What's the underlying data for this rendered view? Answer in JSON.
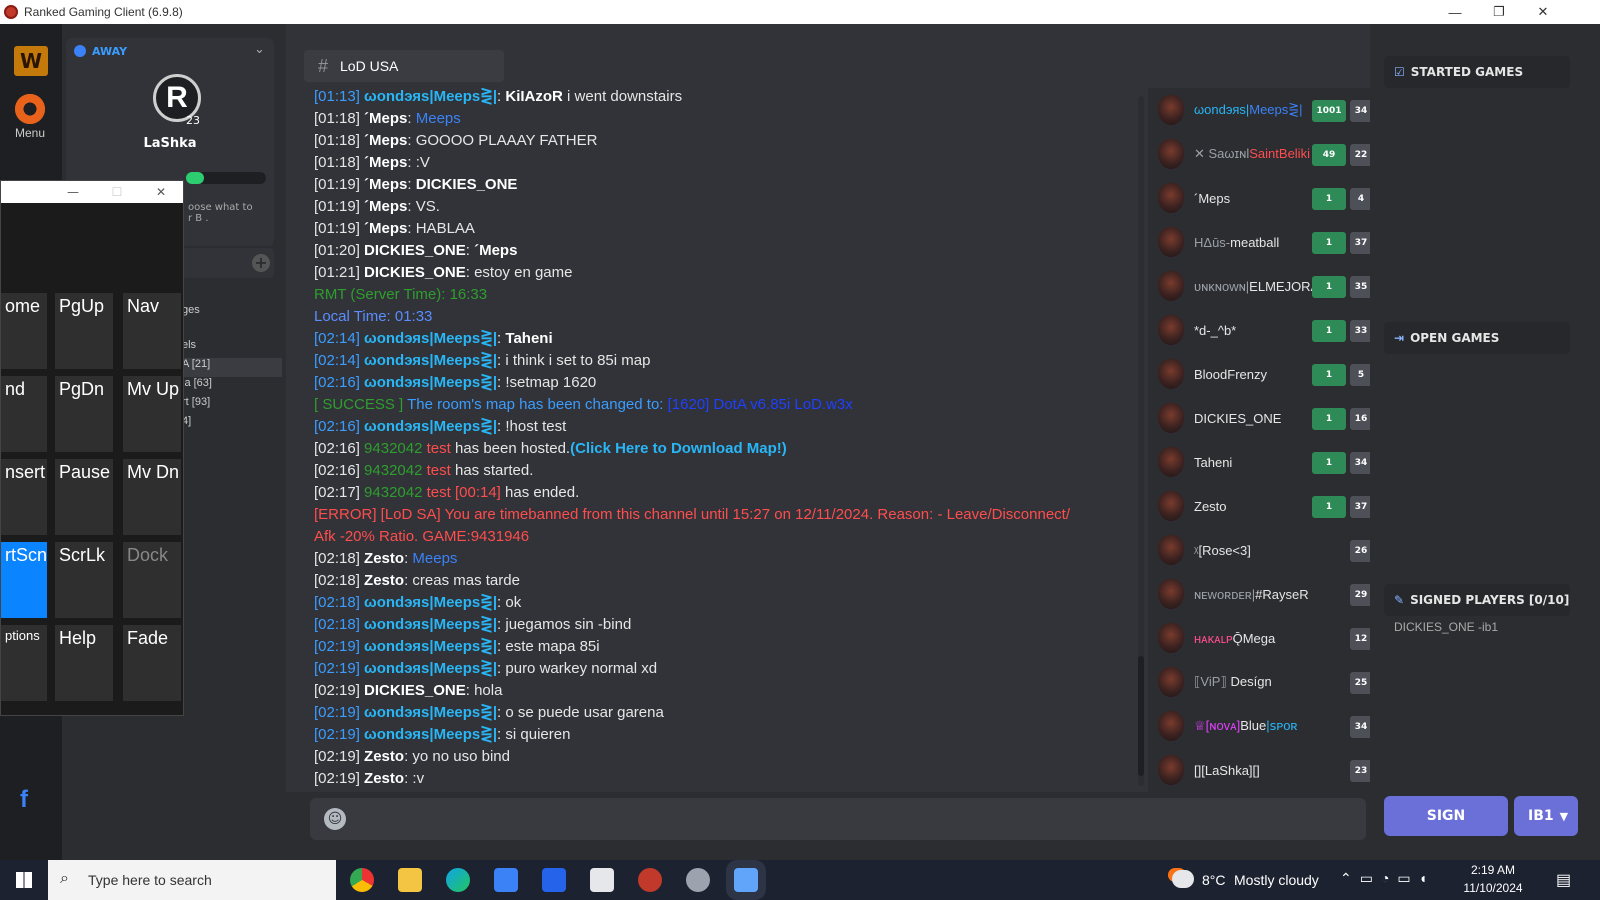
{
  "window": {
    "title": "Ranked Gaming Client (6.9.8)",
    "minimize": "—",
    "restore": "❐",
    "close": "✕"
  },
  "rail": {
    "menu_label": "Menu"
  },
  "profile": {
    "status": "AWAY",
    "name": "LaShka",
    "level": "23",
    "hint": "oose what to\nr B ."
  },
  "sidebar": {
    "partial_items": [
      "ges",
      "els",
      "A [21]",
      "ia [63]",
      "rt [93]",
      "4]"
    ]
  },
  "channel": {
    "hash": "#",
    "name": "LoD USA"
  },
  "chat": {
    "lines": [
      [
        {
          "t": "[01:13] ",
          "c": "#3b9dff"
        },
        {
          "t": "ωondэяs|Meeps⋛|",
          "c": "#29b6f6",
          "b": true
        },
        {
          "t": ": ",
          "c": "#e6e6e6"
        },
        {
          "t": "KiIAzoR",
          "c": "#ffffff",
          "b": true
        },
        {
          "t": " i went downstairs",
          "c": "#e6e6e6"
        }
      ],
      [
        {
          "t": "[01:18] ",
          "c": "#e6e6e6"
        },
        {
          "t": "´Meps",
          "c": "#ffffff",
          "b": true
        },
        {
          "t": ": ",
          "c": "#e6e6e6"
        },
        {
          "t": "Meeps",
          "c": "#3b82f6"
        }
      ],
      [
        {
          "t": "[01:18] ",
          "c": "#e6e6e6"
        },
        {
          "t": "´Meps",
          "c": "#ffffff",
          "b": true
        },
        {
          "t": ": GOOOO PLAAAY FATHER",
          "c": "#e6e6e6"
        }
      ],
      [
        {
          "t": "[01:18] ",
          "c": "#e6e6e6"
        },
        {
          "t": "´Meps",
          "c": "#ffffff",
          "b": true
        },
        {
          "t": ": :V",
          "c": "#e6e6e6"
        }
      ],
      [
        {
          "t": "[01:19] ",
          "c": "#e6e6e6"
        },
        {
          "t": "´Meps",
          "c": "#ffffff",
          "b": true
        },
        {
          "t": ": ",
          "c": "#e6e6e6"
        },
        {
          "t": "DICKIES_ONE",
          "c": "#ffffff",
          "b": true
        }
      ],
      [
        {
          "t": "[01:19] ",
          "c": "#e6e6e6"
        },
        {
          "t": "´Meps",
          "c": "#ffffff",
          "b": true
        },
        {
          "t": ": VS.",
          "c": "#e6e6e6"
        }
      ],
      [
        {
          "t": "[01:19] ",
          "c": "#e6e6e6"
        },
        {
          "t": "´Meps",
          "c": "#ffffff",
          "b": true
        },
        {
          "t": ": HABLAA",
          "c": "#e6e6e6"
        }
      ],
      [
        {
          "t": "[01:20] ",
          "c": "#e6e6e6"
        },
        {
          "t": "DICKIES_ONE",
          "c": "#ffffff",
          "b": true
        },
        {
          "t": ": ",
          "c": "#e6e6e6"
        },
        {
          "t": "´Meps",
          "c": "#ffffff",
          "b": true
        }
      ],
      [
        {
          "t": "[01:21] ",
          "c": "#e6e6e6"
        },
        {
          "t": "DICKIES_ONE",
          "c": "#ffffff",
          "b": true
        },
        {
          "t": ": estoy en game",
          "c": "#e6e6e6"
        }
      ],
      [
        {
          "t": "RMT (Server Time): 16:33",
          "c": "#2e9e2e"
        }
      ],
      [
        {
          "t": "Local Time: 01:33",
          "c": "#5b8dff"
        }
      ],
      [
        {
          "t": "[02:14] ",
          "c": "#3b9dff"
        },
        {
          "t": "ωondэяs|Meeps⋛|",
          "c": "#29b6f6",
          "b": true
        },
        {
          "t": ": ",
          "c": "#e6e6e6"
        },
        {
          "t": "Taheni",
          "c": "#ffffff",
          "b": true
        }
      ],
      [
        {
          "t": "[02:14] ",
          "c": "#3b9dff"
        },
        {
          "t": "ωondэяs|Meeps⋛|",
          "c": "#29b6f6",
          "b": true
        },
        {
          "t": ": i think i set to 85i map",
          "c": "#e6e6e6"
        }
      ],
      [
        {
          "t": "[02:16] ",
          "c": "#3b9dff"
        },
        {
          "t": "ωondэяs|Meeps⋛|",
          "c": "#29b6f6",
          "b": true
        },
        {
          "t": ": !setmap 1620",
          "c": "#e6e6e6"
        }
      ],
      [
        {
          "t": "[ SUCCESS ] ",
          "c": "#2e9e2e"
        },
        {
          "t": "The room's map has been changed to: ",
          "c": "#3b9dff"
        },
        {
          "t": "[1620] DotA v6.85i LoD.w3x",
          "c": "#1e40ff"
        }
      ],
      [
        {
          "t": "[02:16] ",
          "c": "#3b9dff"
        },
        {
          "t": "ωondэяs|Meeps⋛|",
          "c": "#29b6f6",
          "b": true
        },
        {
          "t": ": !host test",
          "c": "#e6e6e6"
        }
      ],
      [
        {
          "t": "[02:16] ",
          "c": "#e6e6e6"
        },
        {
          "t": "9432042 ",
          "c": "#2e9e2e"
        },
        {
          "t": "test ",
          "c": "#ff4d4d"
        },
        {
          "t": "has been hosted.",
          "c": "#e6e6e6"
        },
        {
          "t": "(Click Here to Download Map!)",
          "c": "#29b6f6",
          "b": true
        }
      ],
      [
        {
          "t": "[02:16] ",
          "c": "#e6e6e6"
        },
        {
          "t": "9432042 ",
          "c": "#2e9e2e"
        },
        {
          "t": "test ",
          "c": "#ff4d4d"
        },
        {
          "t": "has started.",
          "c": "#e6e6e6"
        }
      ],
      [
        {
          "t": "[02:17] ",
          "c": "#e6e6e6"
        },
        {
          "t": "9432042 ",
          "c": "#2e9e2e"
        },
        {
          "t": "test [00:14] ",
          "c": "#ff4d4d"
        },
        {
          "t": "has ended.",
          "c": "#e6e6e6"
        }
      ],
      [
        {
          "t": "[ERROR] [LoD SA] You are timebanned from this channel until 15:27 on 12/11/2024. Reason: - Leave/Disconnect/",
          "c": "#ff4d4d"
        }
      ],
      [
        {
          "t": "Afk -20% Ratio. GAME:9431946",
          "c": "#ff4d4d"
        }
      ],
      [
        {
          "t": "[02:18] ",
          "c": "#e6e6e6"
        },
        {
          "t": "Zesto",
          "c": "#ffffff",
          "b": true
        },
        {
          "t": ": ",
          "c": "#e6e6e6"
        },
        {
          "t": "Meeps",
          "c": "#3b82f6"
        }
      ],
      [
        {
          "t": "[02:18] ",
          "c": "#e6e6e6"
        },
        {
          "t": "Zesto",
          "c": "#ffffff",
          "b": true
        },
        {
          "t": ": creas mas tarde",
          "c": "#e6e6e6"
        }
      ],
      [
        {
          "t": "[02:18] ",
          "c": "#3b9dff"
        },
        {
          "t": "ωondэяs|Meeps⋛|",
          "c": "#29b6f6",
          "b": true
        },
        {
          "t": ": ok",
          "c": "#e6e6e6"
        }
      ],
      [
        {
          "t": "[02:18] ",
          "c": "#3b9dff"
        },
        {
          "t": "ωondэяs|Meeps⋛|",
          "c": "#29b6f6",
          "b": true
        },
        {
          "t": ": juegamos sin -bind",
          "c": "#e6e6e6"
        }
      ],
      [
        {
          "t": "[02:19] ",
          "c": "#3b9dff"
        },
        {
          "t": "ωondэяs|Meeps⋛|",
          "c": "#29b6f6",
          "b": true
        },
        {
          "t": ": este mapa 85i",
          "c": "#e6e6e6"
        }
      ],
      [
        {
          "t": "[02:19] ",
          "c": "#3b9dff"
        },
        {
          "t": "ωondэяs|Meeps⋛|",
          "c": "#29b6f6",
          "b": true
        },
        {
          "t": ": puro warkey normal xd",
          "c": "#e6e6e6"
        }
      ],
      [
        {
          "t": "[02:19] ",
          "c": "#e6e6e6"
        },
        {
          "t": "DICKIES_ONE",
          "c": "#ffffff",
          "b": true
        },
        {
          "t": ": hola",
          "c": "#e6e6e6"
        }
      ],
      [
        {
          "t": "[02:19] ",
          "c": "#3b9dff"
        },
        {
          "t": "ωondэяs|Meeps⋛|",
          "c": "#29b6f6",
          "b": true
        },
        {
          "t": ": o se puede usar garena",
          "c": "#e6e6e6"
        }
      ],
      [
        {
          "t": "[02:19] ",
          "c": "#3b9dff"
        },
        {
          "t": "ωondэяs|Meeps⋛|",
          "c": "#29b6f6",
          "b": true
        },
        {
          "t": ": si quieren",
          "c": "#e6e6e6"
        }
      ],
      [
        {
          "t": "[02:19] ",
          "c": "#e6e6e6"
        },
        {
          "t": "Zesto",
          "c": "#ffffff",
          "b": true
        },
        {
          "t": ": yo no uso bind",
          "c": "#e6e6e6"
        }
      ],
      [
        {
          "t": "[02:19] ",
          "c": "#e6e6e6"
        },
        {
          "t": "Zesto",
          "c": "#ffffff",
          "b": true
        },
        {
          "t": ": :v",
          "c": "#e6e6e6"
        }
      ]
    ]
  },
  "users": [
    {
      "parts": [
        {
          "t": "ωondэяs|",
          "c": "#29b6f6"
        },
        {
          "t": "Meeps⋛|",
          "c": "#3b82f6"
        }
      ],
      "green": "1001",
      "grey": "34"
    },
    {
      "parts": [
        {
          "t": "✕ Saωɪɴl",
          "c": "#9aa0a6"
        },
        {
          "t": "SaintBeliki",
          "c": "#ff4d4d"
        }
      ],
      "green": "49",
      "grey": "22"
    },
    {
      "parts": [
        {
          "t": "´Meps",
          "c": "#e6e6e6"
        }
      ],
      "green": "1",
      "grey": "4"
    },
    {
      "parts": [
        {
          "t": "HΔūs-",
          "c": "#9aa0a6"
        },
        {
          "t": "meatball",
          "c": "#e6e6e6"
        }
      ],
      "green": "1",
      "grey": "37"
    },
    {
      "parts": [
        {
          "t": "ᴜɴᴋɴᴏᴡɴ|",
          "c": "#9aa0a6"
        },
        {
          "t": "ELMEJORA",
          "c": "#e6e6e6"
        }
      ],
      "green": "1",
      "grey": "35"
    },
    {
      "parts": [
        {
          "t": "*d-_^b*",
          "c": "#e6e6e6"
        }
      ],
      "green": "1",
      "grey": "33"
    },
    {
      "parts": [
        {
          "t": "BloodFrenzy",
          "c": "#e6e6e6"
        }
      ],
      "green": "1",
      "grey": "5"
    },
    {
      "parts": [
        {
          "t": "DICKIES_ONE",
          "c": "#e6e6e6"
        }
      ],
      "green": "1",
      "grey": "16"
    },
    {
      "parts": [
        {
          "t": "Taheni",
          "c": "#e6e6e6"
        }
      ],
      "green": "1",
      "grey": "34"
    },
    {
      "parts": [
        {
          "t": "Zesto",
          "c": "#e6e6e6"
        }
      ],
      "green": "1",
      "grey": "37"
    },
    {
      "parts": [
        {
          "t": "ᵡ",
          "c": "#9aa0a6"
        },
        {
          "t": "[Rose<3]",
          "c": "#e6e6e6"
        }
      ],
      "green": "",
      "grey": "26"
    },
    {
      "parts": [
        {
          "t": "ɴᴇᴡᴏʀᴅᴇʀ|",
          "c": "#9aa0a6"
        },
        {
          "t": "#RayseR",
          "c": "#e6e6e6"
        }
      ],
      "green": "",
      "grey": "29"
    },
    {
      "parts": [
        {
          "t": "ʜᴀᴋᴀʟᴘ",
          "c": "#ff4d8a"
        },
        {
          "t": "ǬMega",
          "c": "#e6e6e6"
        }
      ],
      "green": "",
      "grey": "12"
    },
    {
      "parts": [
        {
          "t": "⟦ViP⟧ ",
          "c": "#9aa0a6"
        },
        {
          "t": "Desígn",
          "c": "#e6e6e6"
        }
      ],
      "green": "",
      "grey": "25"
    },
    {
      "parts": [
        {
          "t": "♕[ɴᴏᴠᴀ]",
          "c": "#e040fb"
        },
        {
          "t": "Blue",
          "c": "#e6e6e6"
        },
        {
          "t": "|ꜱᴘᴏʀ",
          "c": "#29b6f6"
        }
      ],
      "green": "",
      "grey": "34"
    },
    {
      "parts": [
        {
          "t": "[][LaShka][]",
          "c": "#e6e6e6"
        }
      ],
      "green": "",
      "grey": "23"
    }
  ],
  "right": {
    "started": "STARTED GAMES",
    "open": "OPEN GAMES",
    "signed": "SIGNED PLAYERS [0/10]",
    "signed_player": "DICKIES_ONE -ib1"
  },
  "bottom": {
    "sign_label": "SIGN",
    "region_label": "IB1"
  },
  "osk": {
    "keys": [
      "ome",
      "PgUp",
      "Nav",
      "nd",
      "PgDn",
      "Mv Up",
      "nsert",
      "Pause",
      "Mv Dn",
      "rtScn",
      "ScrLk",
      "Dock",
      "ptions",
      "Help",
      "Fade"
    ]
  },
  "taskbar": {
    "search_placeholder": "Type here to search",
    "temp": "8°C",
    "weather": "Mostly cloudy",
    "time": "2:19 AM",
    "date": "11/10/2024"
  },
  "colors": {
    "accent": "#5865f2",
    "sign": "#6b6fd8",
    "badge_green": "#2e8b57",
    "badge_grey": "#4e5058"
  }
}
